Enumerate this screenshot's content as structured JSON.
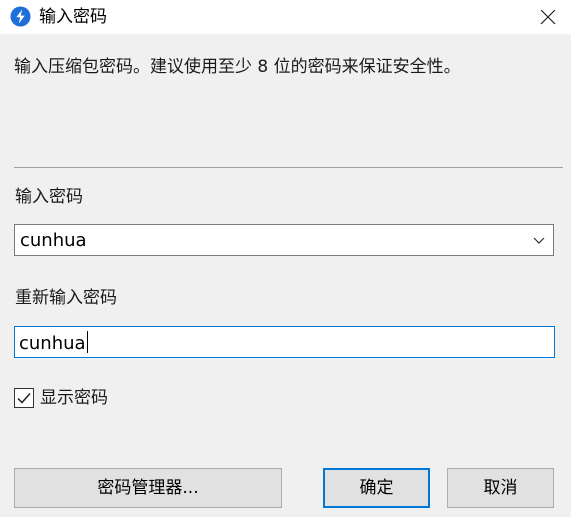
{
  "window": {
    "title": "输入密码",
    "app_icon": "lightning-bolt-icon",
    "close_icon": "close-icon"
  },
  "description": "输入压缩包密码。建议使用至少 8 位的密码来保证安全性。",
  "password": {
    "label": "输入密码",
    "value": "cunhua",
    "dropdown_icon": "chevron-down-icon"
  },
  "confirm": {
    "label": "重新输入密码",
    "value": "cunhua"
  },
  "show_password": {
    "label": "显示密码",
    "checked": true
  },
  "buttons": {
    "manager": "密码管理器...",
    "ok": "确定",
    "cancel": "取消"
  },
  "colors": {
    "accent": "#0078d7",
    "icon_bg": "#1e6fd9",
    "background": "#f0f0f0"
  }
}
